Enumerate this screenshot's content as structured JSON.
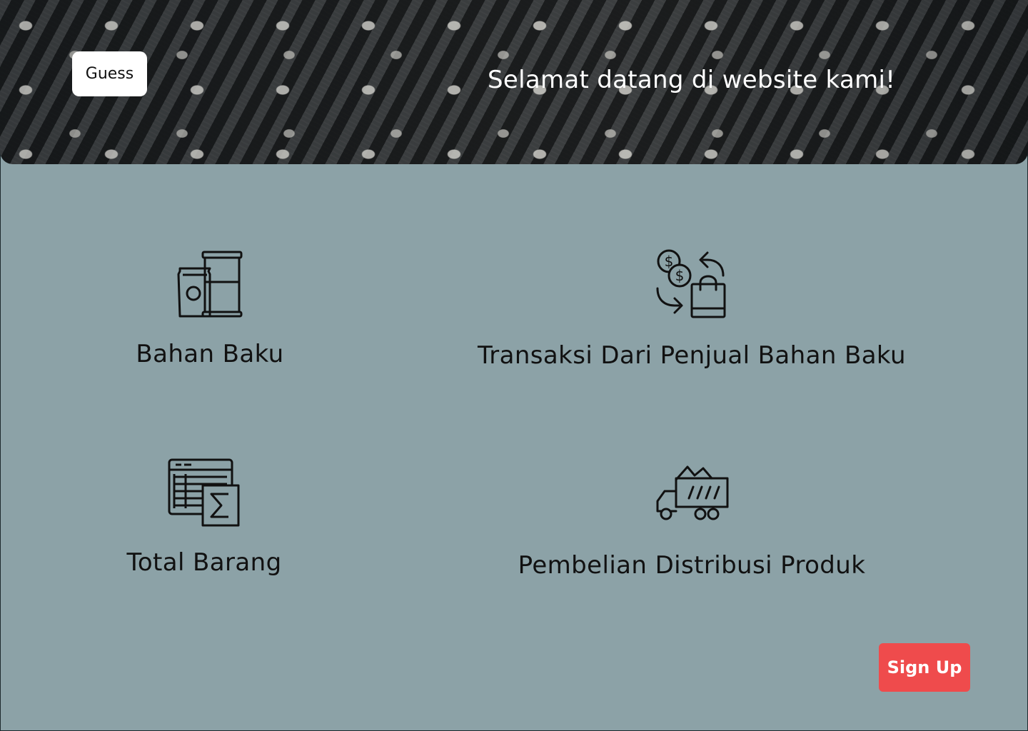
{
  "header": {
    "guest_label": "Guess",
    "welcome_text": "Selamat datang di website kami!"
  },
  "menu": {
    "items": [
      {
        "label": "Bahan Baku",
        "icon": "raw-materials-icon"
      },
      {
        "label": "Transaksi Dari Penjual Bahan Baku",
        "icon": "money-exchange-bag-icon"
      },
      {
        "label": "Total Barang",
        "icon": "spreadsheet-sum-icon"
      },
      {
        "label": "Pembelian Distribusi Produk",
        "icon": "dump-truck-icon"
      }
    ]
  },
  "actions": {
    "signup_label": "Sign Up"
  },
  "colors": {
    "background": "#8ca2a7",
    "signup_button": "#ef4b4c",
    "text": "#111111"
  }
}
